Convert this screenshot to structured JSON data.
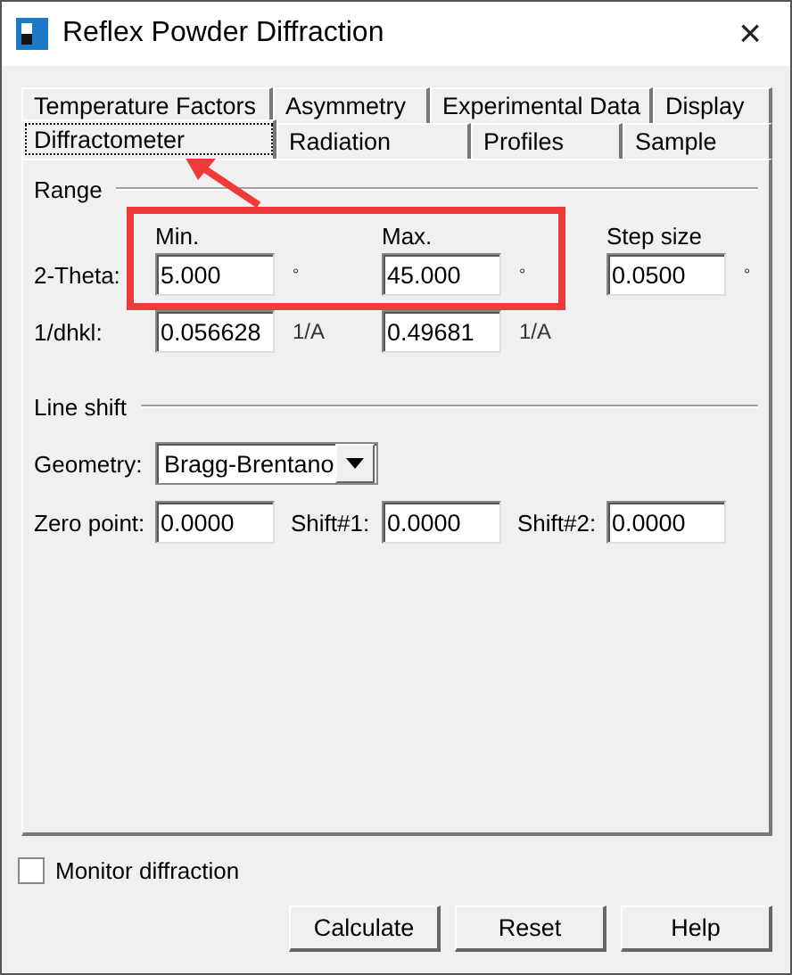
{
  "window": {
    "title": "Reflex Powder Diffraction",
    "close": "×"
  },
  "tabs_back": [
    {
      "label": "Temperature Factors",
      "selected": false
    },
    {
      "label": "Asymmetry",
      "selected": false
    },
    {
      "label": "Experimental Data",
      "selected": false
    },
    {
      "label": "Display",
      "selected": false
    }
  ],
  "tabs_front": [
    {
      "label": "Diffractometer",
      "selected": true
    },
    {
      "label": "Radiation",
      "selected": false
    },
    {
      "label": "Profiles",
      "selected": false
    },
    {
      "label": "Sample",
      "selected": false
    }
  ],
  "range": {
    "title": "Range",
    "headers": [
      "Min.",
      "Max.",
      "Step size"
    ],
    "rows": [
      {
        "label": "2-Theta:",
        "values": [
          "5.000",
          "45.000",
          "0.0500"
        ],
        "units": [
          "°",
          "°",
          "°"
        ]
      },
      {
        "label": "1/dhkl:",
        "values": [
          "0.056628",
          "0.49681"
        ],
        "units": [
          "1/A",
          "1/A"
        ]
      }
    ]
  },
  "line_shift": {
    "title": "Line shift",
    "geometry_label": "Geometry:",
    "geometry": "Bragg-Brentano",
    "shifts": [
      {
        "label": "Zero point:",
        "value": "0.0000"
      },
      {
        "label": "Shift#1:",
        "value": "0.0000"
      },
      {
        "label": "Shift#2:",
        "value": "0.0000"
      }
    ]
  },
  "monitor": {
    "label": "Monitor diffraction",
    "checked": false
  },
  "buttons": [
    "Calculate",
    "Reset",
    "Help"
  ]
}
